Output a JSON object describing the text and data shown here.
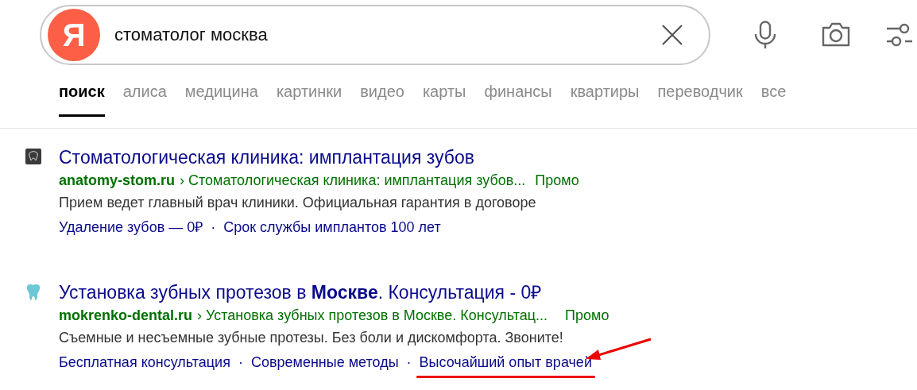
{
  "search": {
    "logo": "Я",
    "query": "стоматолог москва"
  },
  "tabs": [
    {
      "label": "поиск",
      "selected": true
    },
    {
      "label": "алиса",
      "selected": false
    },
    {
      "label": "медицина",
      "selected": false
    },
    {
      "label": "картинки",
      "selected": false
    },
    {
      "label": "видео",
      "selected": false
    },
    {
      "label": "карты",
      "selected": false
    },
    {
      "label": "финансы",
      "selected": false
    },
    {
      "label": "квартиры",
      "selected": false
    },
    {
      "label": "переводчик",
      "selected": false
    },
    {
      "label": "все",
      "selected": false
    }
  ],
  "results": [
    {
      "kind": "clinic",
      "title": "Стоматологическая клиника: имплантация зубов",
      "domain": "anatomy-stom.ru",
      "breadcrumb": "› Стоматологическая клиника: имплантация зубов...",
      "promo": "Промо",
      "snippet": "Прием ведет главный врач клиники. Официальная гарантия в договоре",
      "separator": "·",
      "sitelinks": [
        {
          "text": "Удаление зубов — 0₽",
          "highlighted": false
        },
        {
          "text": "Срок службы имплантов 100 лет",
          "highlighted": false
        }
      ]
    },
    {
      "kind": "tooth",
      "title": "Установка зубных протезов в **Москве**. Консультация - 0₽",
      "domain": "mokrenko-dental.ru",
      "breadcrumb": "› Установка зубных протезов в Москве. Консультац...",
      "promo": "Промо",
      "snippet": "Съемные и несъемные зубные протезы. Без боли и дискомфорта. Звоните!",
      "separator": "·",
      "sitelinks": [
        {
          "text": "Бесплатная консультация",
          "highlighted": false
        },
        {
          "text": "Современные методы",
          "highlighted": false
        },
        {
          "text": "Высочайший опыт врачей",
          "highlighted": true
        }
      ]
    }
  ]
}
